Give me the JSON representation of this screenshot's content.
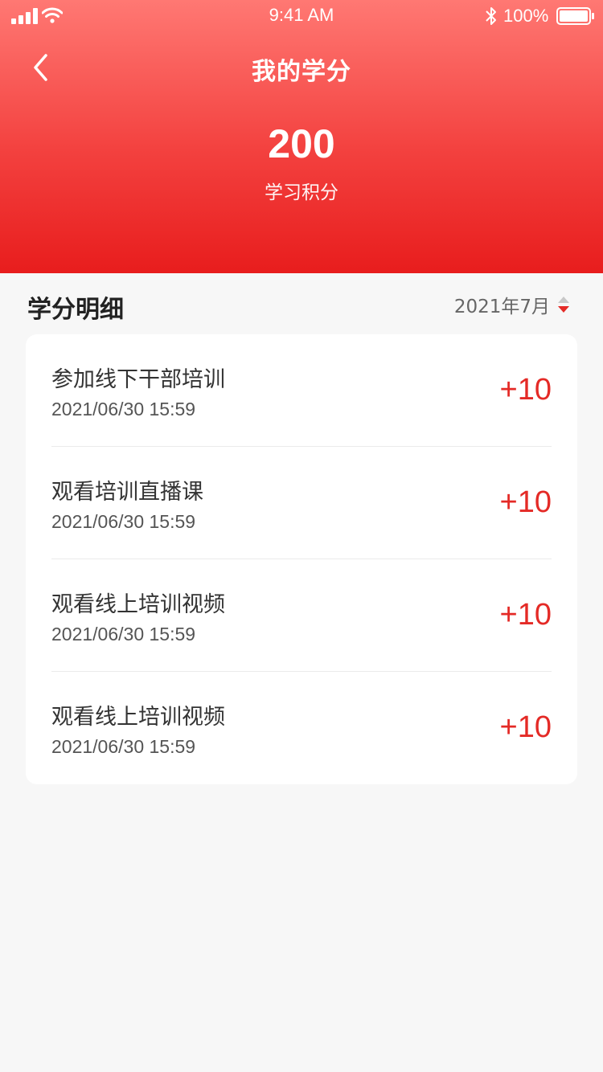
{
  "status_bar": {
    "time": "9:41 AM",
    "battery": "100%",
    "icons": [
      "signal-icon",
      "wifi-icon",
      "bluetooth-icon",
      "battery-icon"
    ]
  },
  "header": {
    "title": "我的学分",
    "back_icon": "chevron-left-icon",
    "score": "200",
    "score_label": "学习积分"
  },
  "section": {
    "title": "学分明细",
    "month": "2021年7月",
    "sort_icon": "sort-caret-icon"
  },
  "records": [
    {
      "title": "参加线下干部培训",
      "time": "2021/06/30 15:59",
      "points": "+10"
    },
    {
      "title": "观看培训直播课",
      "time": "2021/06/30 15:59",
      "points": "+10"
    },
    {
      "title": "观看线上培训视频",
      "time": "2021/06/30 15:59",
      "points": "+10"
    },
    {
      "title": "观看线上培训视频",
      "time": "2021/06/30 15:59",
      "points": "+10"
    }
  ],
  "colors": {
    "accent": "#e42a26",
    "header_top": "#ff7873",
    "header_bottom": "#e81d1d",
    "background": "#f7f7f7"
  }
}
